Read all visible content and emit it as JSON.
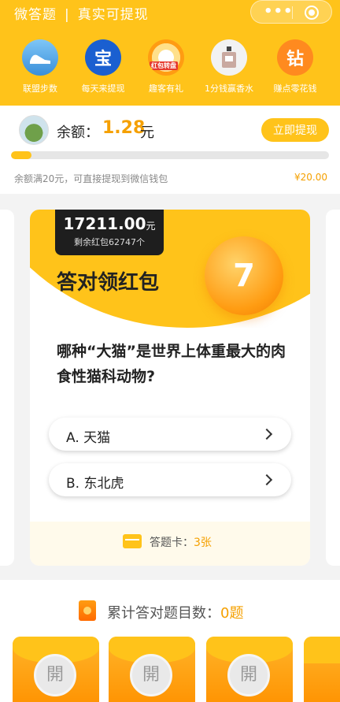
{
  "header": {
    "title_left": "微答题",
    "separator": "|",
    "title_right": "真实可提现",
    "menu_dots": "•••"
  },
  "nav": [
    {
      "label": "联盟步数",
      "icon": "shoe-icon"
    },
    {
      "label": "每天来提现",
      "icon": "treasure-icon",
      "glyph": "宝"
    },
    {
      "label": "趣客有礼",
      "icon": "red-packet-wheel-icon",
      "badge": "红包转盘"
    },
    {
      "label": "1分钱赢香水",
      "icon": "perfume-icon"
    },
    {
      "label": "赚点零花钱",
      "icon": "diamond-icon",
      "glyph": "钻"
    }
  ],
  "balance": {
    "label": "余额：",
    "value": "1.28",
    "unit": "元",
    "withdraw_label": "立即提现",
    "progress": 0.064,
    "hint": "余额满20元，可直接提现到微信钱包",
    "goal": "¥20.00"
  },
  "card": {
    "amount": "17211.00",
    "amount_unit": "元",
    "remaining": "剩余红包62747个",
    "title": "答对领红包",
    "coin_number": "7",
    "question": "哪种“大猫”是世界上体重最大的肉食性猫科动物?",
    "options": [
      "A. 天猫",
      "B. 东北虎"
    ],
    "card_label": "答题卡：",
    "card_count": "3张"
  },
  "stats": {
    "label": "累计答对题目数：",
    "count": "0题"
  },
  "envelopes": [
    "開",
    "開",
    "開"
  ],
  "colors": {
    "accent": "#ffc31a",
    "highlight": "#f5a000"
  }
}
